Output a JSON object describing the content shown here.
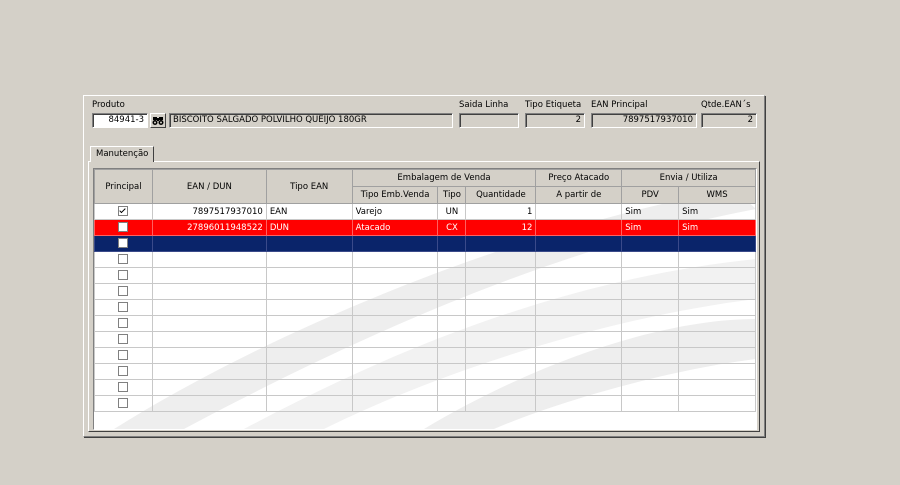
{
  "header": {
    "produto_label": "Produto",
    "produto_code": "84941-3",
    "produto_desc": "BISCOITO SALGADO POLVILHO QUEIJO 180GR",
    "saida_linha_label": "Saida Linha",
    "saida_linha_value": "",
    "tipo_etiqueta_label": "Tipo Etiqueta",
    "tipo_etiqueta_value": "2",
    "ean_principal_label": "EAN Principal",
    "ean_principal_value": "7897517937010",
    "qtde_eans_label": "Qtde.EAN´s",
    "qtde_eans_value": "2"
  },
  "tabs": {
    "manutencao": "Manutenção"
  },
  "grid": {
    "group_headers": {
      "embalagem": "Embalagem de Venda",
      "preco": "Preço Atacado",
      "envia": "Envia / Utiliza"
    },
    "columns": {
      "principal": "Principal",
      "ean": "EAN / DUN",
      "tipo_ean": "Tipo EAN",
      "tipo_emb": "Tipo Emb.Venda",
      "tipo": "Tipo",
      "quantidade": "Quantidade",
      "a_partir": "A partir de",
      "pdv": "PDV",
      "wms": "WMS"
    },
    "rows": [
      {
        "principal": true,
        "ean": "7897517937010",
        "tipo_ean": "EAN",
        "tipo_emb": "Varejo",
        "tipo": "UN",
        "quantidade": "1",
        "a_partir": "",
        "pdv": "Sim",
        "wms": "Sim",
        "style": "normal"
      },
      {
        "principal": false,
        "ean": "27896011948522",
        "tipo_ean": "DUN",
        "tipo_emb": "Atacado",
        "tipo": "CX",
        "quantidade": "12",
        "a_partir": "",
        "pdv": "Sim",
        "wms": "Sim",
        "style": "red"
      },
      {
        "principal": false,
        "ean": "",
        "tipo_ean": "",
        "tipo_emb": "",
        "tipo": "",
        "quantidade": "",
        "a_partir": "",
        "pdv": "",
        "wms": "",
        "style": "sel"
      },
      {
        "principal": false,
        "ean": "",
        "tipo_ean": "",
        "tipo_emb": "",
        "tipo": "",
        "quantidade": "",
        "a_partir": "",
        "pdv": "",
        "wms": "",
        "style": "normal"
      },
      {
        "principal": false,
        "ean": "",
        "tipo_ean": "",
        "tipo_emb": "",
        "tipo": "",
        "quantidade": "",
        "a_partir": "",
        "pdv": "",
        "wms": "",
        "style": "normal"
      },
      {
        "principal": false,
        "ean": "",
        "tipo_ean": "",
        "tipo_emb": "",
        "tipo": "",
        "quantidade": "",
        "a_partir": "",
        "pdv": "",
        "wms": "",
        "style": "normal"
      },
      {
        "principal": false,
        "ean": "",
        "tipo_ean": "",
        "tipo_emb": "",
        "tipo": "",
        "quantidade": "",
        "a_partir": "",
        "pdv": "",
        "wms": "",
        "style": "normal"
      },
      {
        "principal": false,
        "ean": "",
        "tipo_ean": "",
        "tipo_emb": "",
        "tipo": "",
        "quantidade": "",
        "a_partir": "",
        "pdv": "",
        "wms": "",
        "style": "normal"
      },
      {
        "principal": false,
        "ean": "",
        "tipo_ean": "",
        "tipo_emb": "",
        "tipo": "",
        "quantidade": "",
        "a_partir": "",
        "pdv": "",
        "wms": "",
        "style": "normal"
      },
      {
        "principal": false,
        "ean": "",
        "tipo_ean": "",
        "tipo_emb": "",
        "tipo": "",
        "quantidade": "",
        "a_partir": "",
        "pdv": "",
        "wms": "",
        "style": "normal"
      },
      {
        "principal": false,
        "ean": "",
        "tipo_ean": "",
        "tipo_emb": "",
        "tipo": "",
        "quantidade": "",
        "a_partir": "",
        "pdv": "",
        "wms": "",
        "style": "normal"
      },
      {
        "principal": false,
        "ean": "",
        "tipo_ean": "",
        "tipo_emb": "",
        "tipo": "",
        "quantidade": "",
        "a_partir": "",
        "pdv": "",
        "wms": "",
        "style": "normal"
      },
      {
        "principal": false,
        "ean": "",
        "tipo_ean": "",
        "tipo_emb": "",
        "tipo": "",
        "quantidade": "",
        "a_partir": "",
        "pdv": "",
        "wms": "",
        "style": "normal"
      }
    ]
  },
  "colors": {
    "highlight_red": "#ff0000",
    "selection_blue": "#0a246a",
    "face": "#d4d0c8"
  },
  "icons": {
    "search": "binoculars-icon",
    "checkbox": "checkbox-icon"
  }
}
